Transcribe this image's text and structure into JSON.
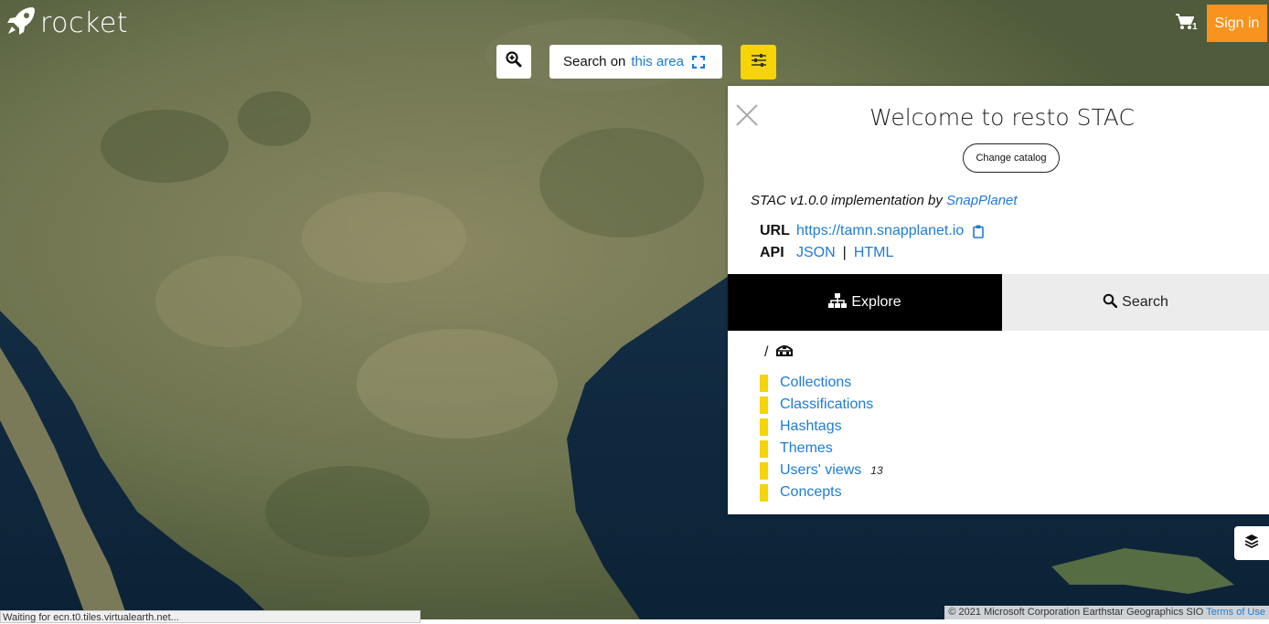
{
  "app": {
    "name": "rocket"
  },
  "header": {
    "cart_count": "1",
    "signin_label": "Sign in"
  },
  "toolbar": {
    "search_label": "Search on",
    "search_link": "this area"
  },
  "panel": {
    "title": "Welcome to resto STAC",
    "change_catalog": "Change catalog",
    "impl_text": "STAC v1.0.0 implementation by",
    "impl_link": "SnapPlanet",
    "url_label": "URL",
    "url_value": "https://tamn.snapplanet.io",
    "api_label": "API",
    "api_json": "JSON",
    "api_sep": "|",
    "api_html": "HTML",
    "tabs": {
      "explore": "Explore",
      "search": "Search"
    },
    "breadcrumb_root": "/",
    "items": [
      {
        "label": "Collections",
        "count": ""
      },
      {
        "label": "Classifications",
        "count": ""
      },
      {
        "label": "Hashtags",
        "count": ""
      },
      {
        "label": "Themes",
        "count": ""
      },
      {
        "label": "Users' views",
        "count": "13"
      },
      {
        "label": "Concepts",
        "count": ""
      }
    ]
  },
  "footer": {
    "status": "Waiting for ecn.t0.tiles.virtualearth.net...",
    "attribution": "© 2021 Microsoft Corporation Earthstar Geographics SIO",
    "terms": "Terms of Use"
  },
  "colors": {
    "accent_yellow": "#f5d40a",
    "signin_orange": "#f7931e",
    "link_blue": "#1f7bd4"
  },
  "icons": [
    "rocket-icon",
    "cart-icon",
    "zoom-in-icon",
    "expand-icon",
    "sliders-icon",
    "close-icon",
    "clipboard-icon",
    "sitemap-icon",
    "search-icon",
    "catalog-icon",
    "layers-icon"
  ]
}
